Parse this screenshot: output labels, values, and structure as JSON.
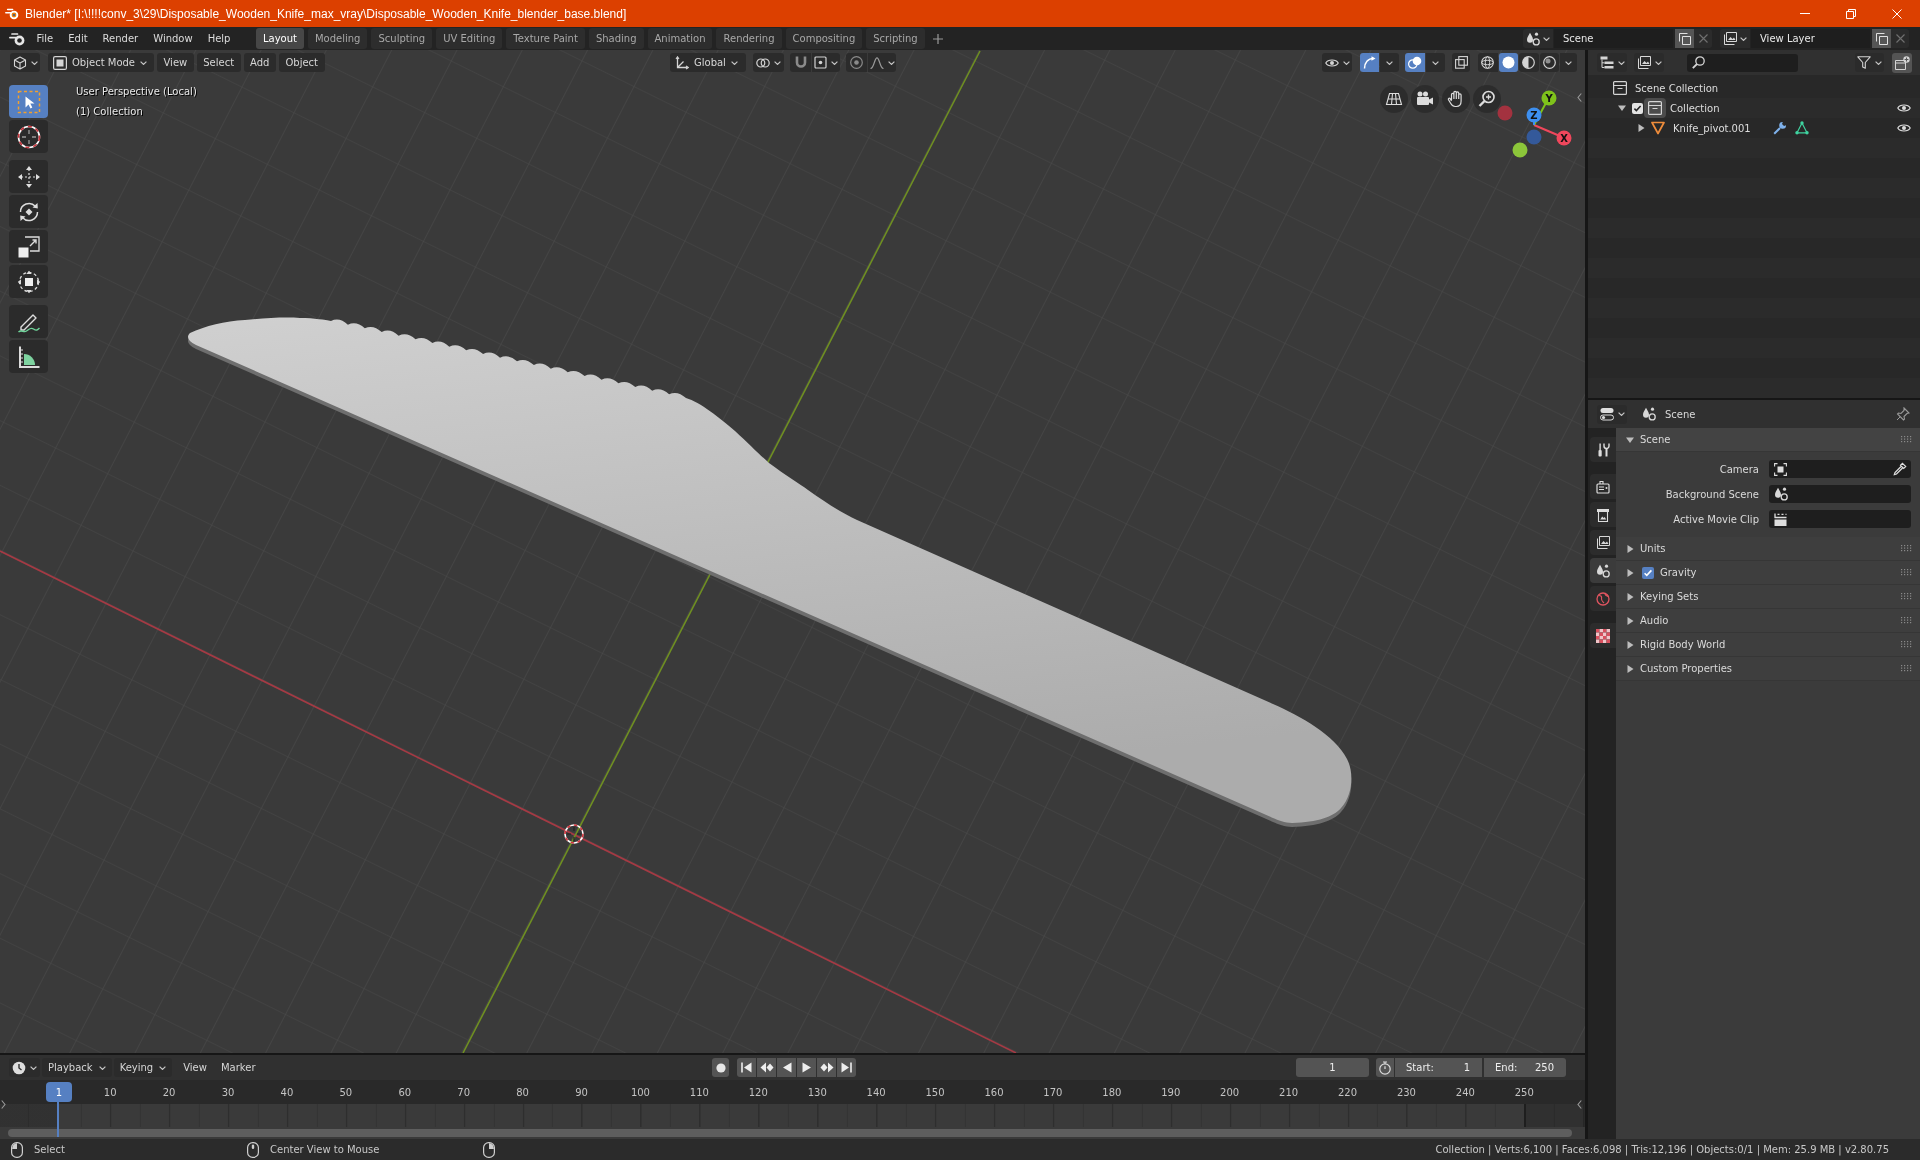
{
  "window": {
    "title": "Blender* [I:\\!!!!conv_3\\29\\Disposable_Wooden_Knife_max_vray\\Disposable_Wooden_Knife_blender_base.blend]"
  },
  "top_bar": {
    "menus": [
      "File",
      "Edit",
      "Render",
      "Window",
      "Help"
    ],
    "workspaces": [
      {
        "label": "Layout",
        "selected": true
      },
      {
        "label": "Modeling",
        "selected": false
      },
      {
        "label": "Sculpting",
        "selected": false
      },
      {
        "label": "UV Editing",
        "selected": false
      },
      {
        "label": "Texture Paint",
        "selected": false
      },
      {
        "label": "Shading",
        "selected": false
      },
      {
        "label": "Animation",
        "selected": false
      },
      {
        "label": "Rendering",
        "selected": false
      },
      {
        "label": "Compositing",
        "selected": false
      },
      {
        "label": "Scripting",
        "selected": false
      }
    ],
    "scene": "Scene",
    "view_layer": "View Layer"
  },
  "viewport": {
    "header": {
      "mode": "Object Mode",
      "menus": [
        "View",
        "Select",
        "Add",
        "Object"
      ],
      "orientation": "Global",
      "toggles": [
        {
          "kind": "gizmos",
          "on": true
        },
        {
          "kind": "overlays",
          "on": true
        },
        {
          "kind": "xray",
          "on": false
        }
      ],
      "shading": [
        {
          "kind": "wireframe",
          "selected": false
        },
        {
          "kind": "solid",
          "selected": true
        },
        {
          "kind": "material",
          "selected": false
        },
        {
          "kind": "rendered",
          "selected": false
        }
      ]
    },
    "info": [
      "User Perspective (Local)",
      "(1) Collection"
    ],
    "toolbar": [
      [
        {
          "kind": "select_box",
          "selected": true
        },
        {
          "kind": "cursor",
          "selected": false
        }
      ],
      [
        {
          "kind": "move",
          "selected": false
        },
        {
          "kind": "rotate",
          "selected": false
        },
        {
          "kind": "scale",
          "selected": false
        },
        {
          "kind": "transform",
          "selected": false
        }
      ],
      [
        {
          "kind": "annotate",
          "selected": false
        },
        {
          "kind": "measure",
          "selected": false
        }
      ]
    ],
    "navigation_gizmo": [
      "X",
      "Y",
      "Z"
    ]
  },
  "outliner": {
    "tree": [
      {
        "label": "Scene Collection",
        "kind": "scene_collection",
        "selected": false,
        "children": [
          {
            "label": "Collection",
            "kind": "collection",
            "selected": true,
            "expanded": true,
            "checked": true,
            "visible": true,
            "children": [
              {
                "label": "Knife_pivot.001",
                "kind": "mesh_object",
                "selected": false,
                "expanded": false,
                "visible": true
              }
            ]
          }
        ]
      }
    ]
  },
  "properties": {
    "context": "Scene",
    "tab_groups": [
      [
        {
          "kind": "tool",
          "selected": false
        }
      ],
      [
        {
          "kind": "render",
          "selected": false
        },
        {
          "kind": "output",
          "selected": false
        },
        {
          "kind": "view_layer",
          "selected": false
        },
        {
          "kind": "scene",
          "selected": true
        },
        {
          "kind": "world",
          "selected": false
        }
      ],
      [
        {
          "kind": "texture",
          "selected": false
        }
      ]
    ],
    "panels": [
      {
        "label": "Scene",
        "expanded": true,
        "fields": [
          {
            "label": "Camera",
            "kind": "camera"
          },
          {
            "label": "Background Scene",
            "kind": "scene"
          },
          {
            "label": "Active Movie Clip",
            "kind": "movie_clip"
          }
        ]
      },
      {
        "label": "Units",
        "expanded": false
      },
      {
        "label": "Gravity",
        "expanded": false,
        "checked": true
      },
      {
        "label": "Keying Sets",
        "expanded": false
      },
      {
        "label": "Audio",
        "expanded": false
      },
      {
        "label": "Rigid Body World",
        "expanded": false
      },
      {
        "label": "Custom Properties",
        "expanded": false
      }
    ]
  },
  "timeline": {
    "dropdowns": [
      "Playback",
      "Keying"
    ],
    "menus": [
      "View",
      "Marker"
    ],
    "current_frame": "1",
    "start": {
      "label": "Start:",
      "value": "1"
    },
    "end": {
      "label": "End:",
      "value": "250"
    },
    "playhead": "1",
    "frame_labels": [
      "10",
      "20",
      "30",
      "40",
      "50",
      "60",
      "70",
      "80",
      "90",
      "100",
      "110",
      "120",
      "130",
      "140",
      "150",
      "160",
      "170",
      "180",
      "190",
      "200",
      "210",
      "220",
      "230",
      "240",
      "250"
    ]
  },
  "status_bar": {
    "hints": [
      {
        "kind": "left_mouse",
        "label": "Select"
      },
      {
        "kind": "middle_mouse",
        "label": "Center View to Mouse"
      },
      {
        "kind": "right_mouse"
      }
    ],
    "stats": "Collection | Verts:6,100 | Faces:6,098 | Tris:12,196 | Objects:0/1 | Mem: 25.9 MB | v2.80.75"
  }
}
